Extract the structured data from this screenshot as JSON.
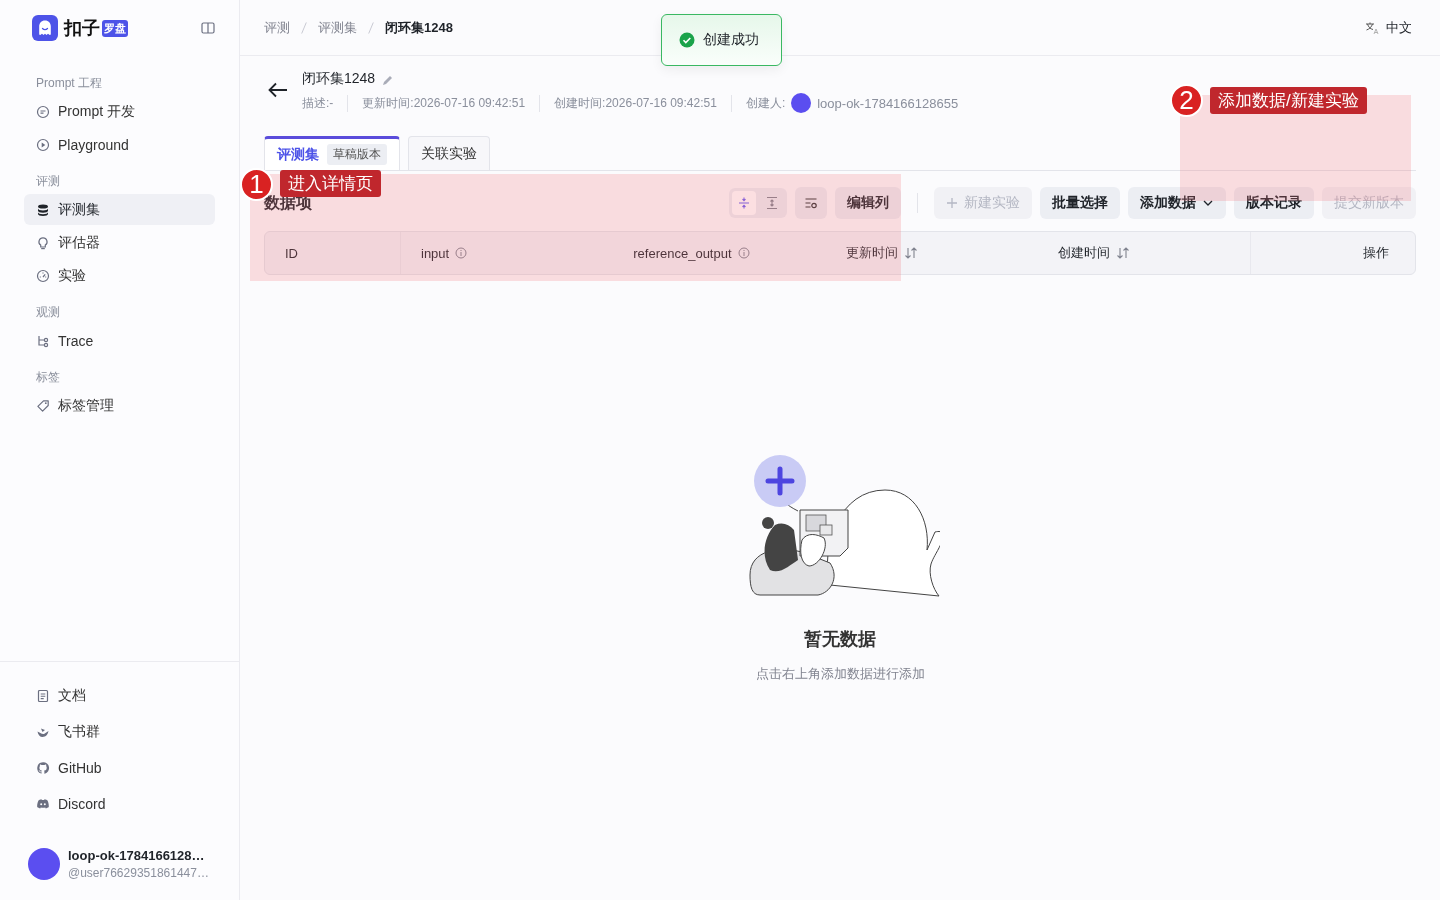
{
  "sidebar": {
    "brand": {
      "name": "扣子",
      "badge": "罗盘"
    },
    "groups": [
      {
        "title": "Prompt 工程",
        "items": [
          {
            "label": "Prompt 开发",
            "selected": false
          },
          {
            "label": "Playground",
            "selected": false
          }
        ]
      },
      {
        "title": "评测",
        "items": [
          {
            "label": "评测集",
            "selected": true
          },
          {
            "label": "评估器",
            "selected": false
          },
          {
            "label": "实验",
            "selected": false
          }
        ]
      },
      {
        "title": "观测",
        "items": [
          {
            "label": "Trace",
            "selected": false
          }
        ]
      },
      {
        "title": "标签",
        "items": [
          {
            "label": "标签管理",
            "selected": false
          }
        ]
      }
    ],
    "footer_links": [
      {
        "label": "文档"
      },
      {
        "label": "飞书群"
      },
      {
        "label": "GitHub"
      },
      {
        "label": "Discord"
      }
    ],
    "user": {
      "name": "loop-ok-1784166128…",
      "handle": "@user76629351861447…"
    }
  },
  "breadcrumb": [
    "评测",
    "评测集",
    "闭环集1248"
  ],
  "language": "中文",
  "toast": {
    "message": "创建成功"
  },
  "dataset": {
    "name": "闭环集1248",
    "meta": [
      "描述:-",
      "更新时间:2026-07-16 09:42:51",
      "创建时间:2026-07-16 09:42:51"
    ],
    "creator_label": "创建人:",
    "creator": "loop-ok-1784166128655"
  },
  "tabs": [
    {
      "label": "评测集",
      "badge": "草稿版本",
      "selected": true
    },
    {
      "label": "关联实验",
      "selected": false
    }
  ],
  "section_title": "数据项",
  "density": [
    {
      "kind": "compact",
      "selected": true
    },
    {
      "kind": "expand",
      "selected": false
    }
  ],
  "buttons": [
    {
      "label": "编辑列",
      "kind": "plain",
      "disabled": false
    },
    {
      "label": "新建实验",
      "kind": "add",
      "disabled": true
    },
    {
      "label": "批量选择",
      "kind": "plain",
      "disabled": false
    },
    {
      "label": "添加数据",
      "kind": "dropdown",
      "disabled": false
    },
    {
      "label": "版本记录",
      "kind": "plain",
      "disabled": false
    },
    {
      "label": "提交新版本",
      "kind": "plain",
      "disabled": true
    }
  ],
  "table": {
    "columns": [
      {
        "label": "ID"
      },
      {
        "label": "input",
        "info": true
      },
      {
        "label": "reference_output",
        "info": true
      },
      {
        "label": "更新时间",
        "sortable": true
      },
      {
        "label": "创建时间",
        "sortable": true
      },
      {
        "label": "操作"
      }
    ]
  },
  "empty": {
    "title": "暂无数据",
    "hint": "点击右上角添加数据进行添加"
  },
  "annotations": [
    {
      "number": "1",
      "label": "进入详情页"
    },
    {
      "number": "2",
      "label": "添加数据/新建实验"
    }
  ]
}
